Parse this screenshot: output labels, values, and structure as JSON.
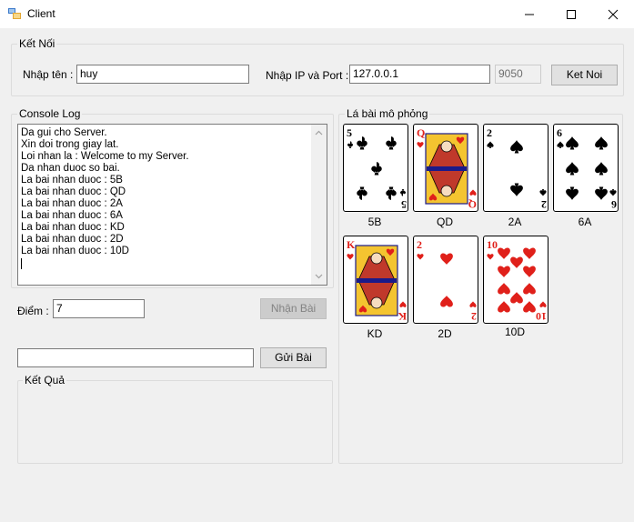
{
  "window": {
    "title": "Client"
  },
  "connection": {
    "group_title": "Kết Nối",
    "name_label": "Nhập tên :",
    "name_value": "huy",
    "ip_label": "Nhập IP và Port :",
    "ip_value": "127.0.0.1",
    "port_value": "9050",
    "connect_label": "Ket Noi"
  },
  "console": {
    "group_title": "Console Log",
    "lines": [
      "Da gui cho Server.",
      "Xin doi trong giay lat.",
      "Loi nhan la : Welcome to my Server.",
      "Da nhan duoc so bai.",
      "La bai nhan duoc : 5B",
      "La bai nhan duoc : QD",
      "La bai nhan duoc : 2A",
      "La bai nhan duoc : 6A",
      "La bai nhan duoc : KD",
      "La bai nhan duoc : 2D",
      "La bai nhan duoc : 10D"
    ]
  },
  "score": {
    "label": "Điểm :",
    "value": "7",
    "receive_label": "Nhận Bài"
  },
  "send": {
    "input_value": "",
    "send_label": "Gửi Bài"
  },
  "result": {
    "group_title": "Kết Quả"
  },
  "cards": {
    "group_title": "Lá bài mô phỏng",
    "items": [
      {
        "code": "5B",
        "rank": "5",
        "suit": "club",
        "color": "#000000"
      },
      {
        "code": "QD",
        "rank": "Q",
        "suit": "heart",
        "color": "#e0201a"
      },
      {
        "code": "2A",
        "rank": "2",
        "suit": "spade",
        "color": "#000000"
      },
      {
        "code": "6A",
        "rank": "6",
        "suit": "spade",
        "color": "#000000"
      },
      {
        "code": "KD",
        "rank": "K",
        "suit": "heart",
        "color": "#e0201a"
      },
      {
        "code": "2D",
        "rank": "2",
        "suit": "heart",
        "color": "#e0201a"
      },
      {
        "code": "10D",
        "rank": "10",
        "suit": "heart",
        "color": "#e0201a"
      }
    ]
  }
}
